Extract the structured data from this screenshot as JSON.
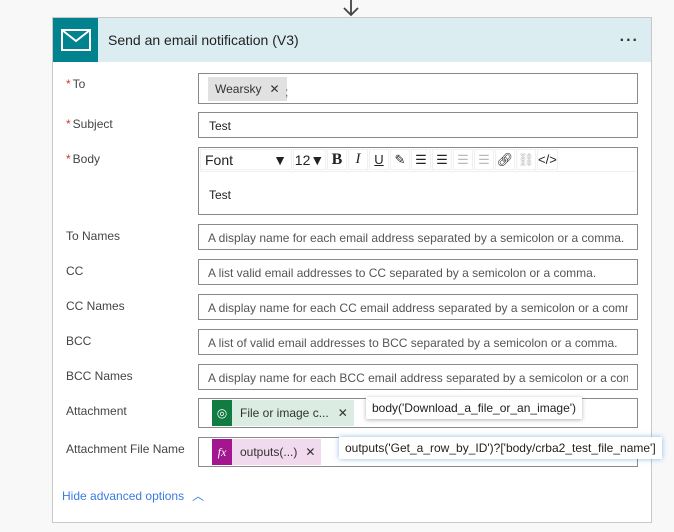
{
  "header": {
    "title": "Send an email notification (V3)",
    "menu": "..."
  },
  "fields": {
    "to": {
      "label": "To",
      "token": "Wearsky",
      "separator": ";"
    },
    "subject": {
      "label": "Subject",
      "value": "Test"
    },
    "body": {
      "label": "Body",
      "font": "Font",
      "size": "12",
      "value": "Test"
    },
    "to_names": {
      "label": "To Names",
      "placeholder": "A display name for each email address separated by a semicolon or a comma."
    },
    "cc": {
      "label": "CC",
      "placeholder": "A list valid email addresses to CC separated by a semicolon or a comma."
    },
    "cc_names": {
      "label": "CC Names",
      "placeholder": "A display name for each CC email address separated by a semicolon or a comma."
    },
    "bcc": {
      "label": "BCC",
      "placeholder": "A list of valid email addresses to BCC separated by a semicolon or a comma."
    },
    "bcc_names": {
      "label": "BCC Names",
      "placeholder": "A display name for each BCC email address separated by a semicolon or a comma."
    },
    "attachment": {
      "label": "Attachment",
      "token": "File or image c...",
      "tooltip": "body('Download_a_file_or_an_image')"
    },
    "attachment_name": {
      "label": "Attachment File Name",
      "token": "outputs(...)",
      "tooltip": "outputs('Get_a_row_by_ID')?['body/crba2_test_file_name']"
    }
  },
  "hide_advanced": "Hide advanced options",
  "colors": {
    "accent": "#00838f",
    "header_bg": "#dbedf1",
    "dataverse": "#107c41",
    "expression": "#a4168f",
    "link": "#3a7be0"
  }
}
